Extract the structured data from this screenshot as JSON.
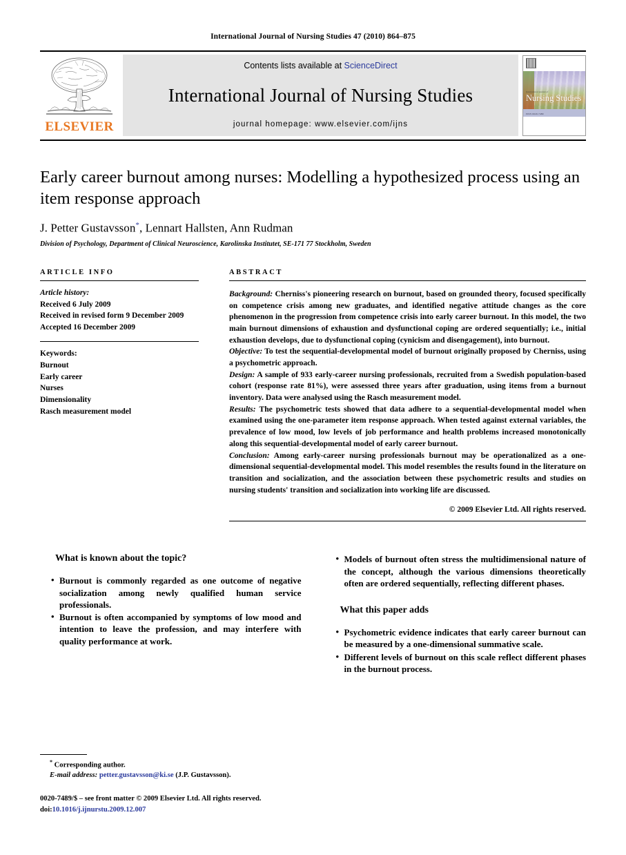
{
  "running_head": "International Journal of Nursing Studies 47 (2010) 864–875",
  "masthead": {
    "publisher_wordmark": "ELSEVIER",
    "contents_prefix": "Contents lists available at ",
    "contents_link": "ScienceDirect",
    "journal_title": "International Journal of Nursing Studies",
    "homepage": "journal homepage: www.elsevier.com/ijns",
    "cover": {
      "journal_name": "Nursing Studies",
      "top_line": "international journal of",
      "band_text": "ISSN 0020-7489"
    }
  },
  "article": {
    "title": "Early career burnout among nurses: Modelling a hypothesized process using an item response approach",
    "authors": "J. Petter Gustavsson",
    "authors_rest": ", Lennart Hallsten, Ann Rudman",
    "corresponding_marker": "*",
    "affiliation": "Division of Psychology, Department of Clinical Neuroscience, Karolinska Institutet, SE-171 77 Stockholm, Sweden"
  },
  "info": {
    "heading": "ARTICLE INFO",
    "history_label": "Article history:",
    "history": [
      "Received 6 July 2009",
      "Received in revised form 9 December 2009",
      "Accepted 16 December 2009"
    ],
    "keywords_label": "Keywords:",
    "keywords": [
      "Burnout",
      "Early career",
      "Nurses",
      "Dimensionality",
      "Rasch measurement model"
    ]
  },
  "abstract": {
    "heading": "ABSTRACT",
    "sections": [
      {
        "label": "Background:",
        "text": " Cherniss's pioneering research on burnout, based on grounded theory, focused specifically on competence crisis among new graduates, and identified negative attitude changes as the core phenomenon in the progression from competence crisis into early career burnout. In this model, the two main burnout dimensions of exhaustion and dysfunctional coping are ordered sequentially; i.e., initial exhaustion develops, due to dysfunctional coping (cynicism and disengagement), into burnout."
      },
      {
        "label": "Objective:",
        "text": " To test the sequential-developmental model of burnout originally proposed by Cherniss, using a psychometric approach."
      },
      {
        "label": "Design:",
        "text": " A sample of 933 early-career nursing professionals, recruited from a Swedish population-based cohort (response rate 81%), were assessed three years after graduation, using items from a burnout inventory. Data were analysed using the Rasch measurement model."
      },
      {
        "label": "Results:",
        "text": " The psychometric tests showed that data adhere to a sequential-developmental model when examined using the one-parameter item response approach. When tested against external variables, the prevalence of low mood, low levels of job performance and health problems increased monotonically along this sequential-developmental model of early career burnout."
      },
      {
        "label": "Conclusion:",
        "text": " Among early-career nursing professionals burnout may be operationalized as a one-dimensional sequential-developmental model. This model resembles the results found in the literature on transition and socialization, and the association between these psychometric results and studies on nursing students' transition and socialization into working life are discussed."
      }
    ],
    "copyright": "© 2009 Elsevier Ltd. All rights reserved."
  },
  "highlights": {
    "known_heading": "What is known about the topic?",
    "known_bullets": [
      "Burnout is commonly regarded as one outcome of negative socialization among newly qualified human service professionals.",
      "Burnout is often accompanied by symptoms of low mood and intention to leave the profession, and may interfere with quality performance at work."
    ],
    "known_bullets_right": [
      "Models of burnout often stress the multidimensional nature of the concept, although the various dimensions theoretically often are ordered sequentially, reflecting different phases."
    ],
    "adds_heading": "What this paper adds",
    "adds_bullets": [
      "Psychometric evidence indicates that early career burnout can be measured by a one-dimensional summative scale.",
      "Different levels of burnout on this scale reflect different phases in the burnout process."
    ]
  },
  "footnotes": {
    "corresponding": "Corresponding author.",
    "email_label": "E-mail address:",
    "email": "petter.gustavsson@ki.se",
    "email_suffix": " (J.P. Gustavsson).",
    "front_matter": "0020-7489/$ – see front matter © 2009 Elsevier Ltd. All rights reserved.",
    "doi_label": "doi:",
    "doi": "10.1016/j.ijnurstu.2009.12.007"
  },
  "colors": {
    "elsevier_orange": "#E87722",
    "link_blue": "#2b3a9c",
    "banner_gray": "#e4e4e4"
  }
}
